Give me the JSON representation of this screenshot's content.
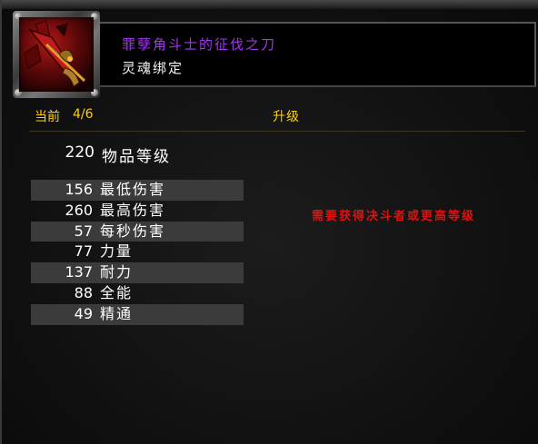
{
  "item": {
    "name": "罪孽角斗士的征伐之刀",
    "binding": "灵魂绑定",
    "icon": "sword-dagger-icon"
  },
  "upgrade": {
    "label": "当前",
    "level": "4/6",
    "action": "升级"
  },
  "item_level": {
    "value": "220",
    "label": "物品等级"
  },
  "stats": [
    {
      "value": "156",
      "label": "最低伤害"
    },
    {
      "value": "260",
      "label": "最高伤害"
    },
    {
      "value": "57",
      "label": "每秒伤害"
    },
    {
      "value": "77",
      "label": "力量"
    },
    {
      "value": "137",
      "label": "耐力"
    },
    {
      "value": "88",
      "label": "全能"
    },
    {
      "value": "49",
      "label": "精通"
    }
  ],
  "requirement": "需要获得决斗者或更高等级",
  "colors": {
    "item_name": "#a335ee",
    "upgrade_text": "#ffd200",
    "requirement_text": "#e01010",
    "stat_shade": "#3b3b3b"
  }
}
